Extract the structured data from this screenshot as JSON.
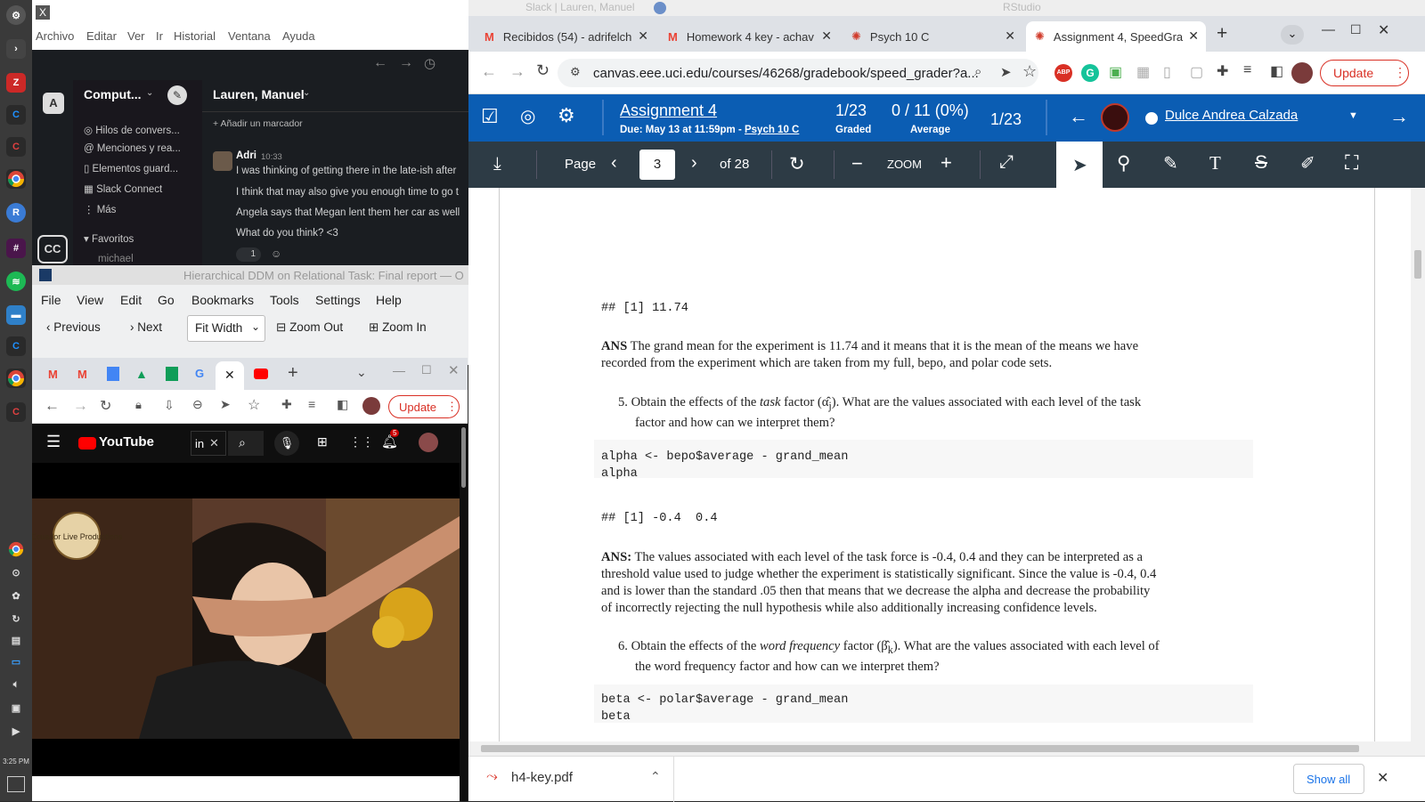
{
  "dock": {
    "items": [
      "settings-icon",
      "terminal-icon",
      "zotero-icon",
      "rstudio-icon",
      "rstudio-icon",
      "chrome-icon",
      "rstudio-icon",
      "r-icon",
      "slack-icon",
      "spotify-icon",
      "files-icon",
      "rstudio-icon",
      "chrome-icon",
      "rstudio-icon"
    ],
    "time": "3:25 PM"
  },
  "slack": {
    "menu": [
      "Archivo",
      "Editar",
      "Ver",
      "Ir",
      "Historial",
      "Ventana",
      "Ayuda"
    ],
    "workspace_initial": "A",
    "workspace_name": "Comput...",
    "channel_title": "Lauren, Manuel",
    "add_bookmark": "+ Añadir un marcador",
    "nav": [
      "Hilos de convers...",
      "Menciones y rea...",
      "Elementos guard...",
      "Slack Connect",
      "Más"
    ],
    "favorites_label": "Favoritos",
    "favorite_partial": "michael",
    "cc_label": "CC",
    "message": {
      "author": "Adri",
      "time": "10:33",
      "lines": [
        "I was thinking of getting there in the late-ish after",
        "I think that may also give you enough time to go t",
        "Angela says that Megan lent them her car as well",
        "What do you think? <3"
      ],
      "reaction_count": "1"
    }
  },
  "okular": {
    "title": "Hierarchical DDM on Relational Task: Final report — O",
    "menu": [
      "File",
      "View",
      "Edit",
      "Go",
      "Bookmarks",
      "Tools",
      "Settings",
      "Help"
    ],
    "toolbar": {
      "previous": "Previous",
      "next": "Next",
      "fit": "Fit Width",
      "zoom_out": "Zoom Out",
      "zoom_in": "Zoom In"
    }
  },
  "yt_browser": {
    "update_label": "Update",
    "youtube_label": "YouTube",
    "search_value": "in",
    "notification_count": "5",
    "channel_watermark": "Ecuador Live Productions"
  },
  "chrome": {
    "window_title_left": "Slack | Lauren, Manuel",
    "window_title_right": "RStudio",
    "tabs": [
      {
        "icon": "gmail-icon",
        "title": "Recibidos (54) - adrifelch"
      },
      {
        "icon": "gmail-icon",
        "title": "Homework 4 key - achav"
      },
      {
        "icon": "canvas-icon",
        "title": "Psych 10 C"
      },
      {
        "icon": "canvas-icon",
        "title": "Assignment 4, SpeedGra"
      }
    ],
    "url": "canvas.eee.uci.edu/courses/46268/gradebook/speed_grader?a...",
    "update_label": "Update",
    "abp_label": "ABP"
  },
  "speedgrader": {
    "assignment_title": "Assignment 4",
    "due_prefix": "Due: May 13 at 11:59pm - ",
    "course_link": "Psych 10 C",
    "graded_value": "1/23",
    "graded_label": "Graded",
    "average_value": "0 / 11 (0%)",
    "average_label": "Average",
    "student_position": "1/23",
    "student_name": "Dulce Andrea Calzada",
    "toolbar": {
      "page_label": "Page",
      "page_value": "3",
      "of_pages": "of 28",
      "zoom_label": "ZOOM"
    }
  },
  "document": {
    "out1": "## [1] 11.74",
    "ans1": "The grand mean for the experiment is 11.74 and it means that it is the mean of the means we have recorded from the experiment which are taken from my full, bepo, and polar code sets.",
    "ans1_line1": "The grand mean for the experiment is 11.74 and it means that it is the mean of the means we have",
    "ans1_line2": "recorded from the experiment which are taken from my full, bepo, and polar code sets.",
    "q5_line1": "5. Obtain the effects of the",
    "q5_italic": "task",
    "q5_line1b": "factor (α̂",
    "q5_sub": "j",
    "q5_line1c": "). What are the values associated with each level of the task",
    "q5_line2": "factor and how can we interpret them?",
    "code1_l1": "alpha <- bepo$average - grand_mean",
    "code1_l2": "alpha",
    "out2": "## [1] -0.4  0.4",
    "ans_label": "ANS",
    "ans2_label": "ANS:",
    "ans2_lines": [
      "The values associated with each level of the task force is -0.4, 0.4 and they can be interpreted as a",
      "threshold value used to judge whether the experiment is statistically significant. Since the value is -0.4, 0.4",
      "and is lower than the standard .05 then that means that we decrease the alpha and decrease the probability",
      "of incorrectly rejecting the null hypothesis while also additionally increasing confidence levels."
    ],
    "q6_line1a": "6. Obtain the effects of the",
    "q6_italic": "word frequency",
    "q6_line1b": "factor (β̂",
    "q6_sub": "k",
    "q6_line1c": "). What are the values associated with each level of",
    "q6_line2": "the word frequency factor and how can we interpret them?",
    "code2_l1": "beta <- polar$average - grand_mean",
    "code2_l2": "beta"
  },
  "downloads": {
    "file_name": "h4-key.pdf",
    "show_all": "Show all"
  },
  "colors": {
    "canvas_blue": "#0b5db3",
    "toolbar_dark": "#2d3b45",
    "update_red": "#d93025",
    "youtube_red": "#ff0000"
  }
}
